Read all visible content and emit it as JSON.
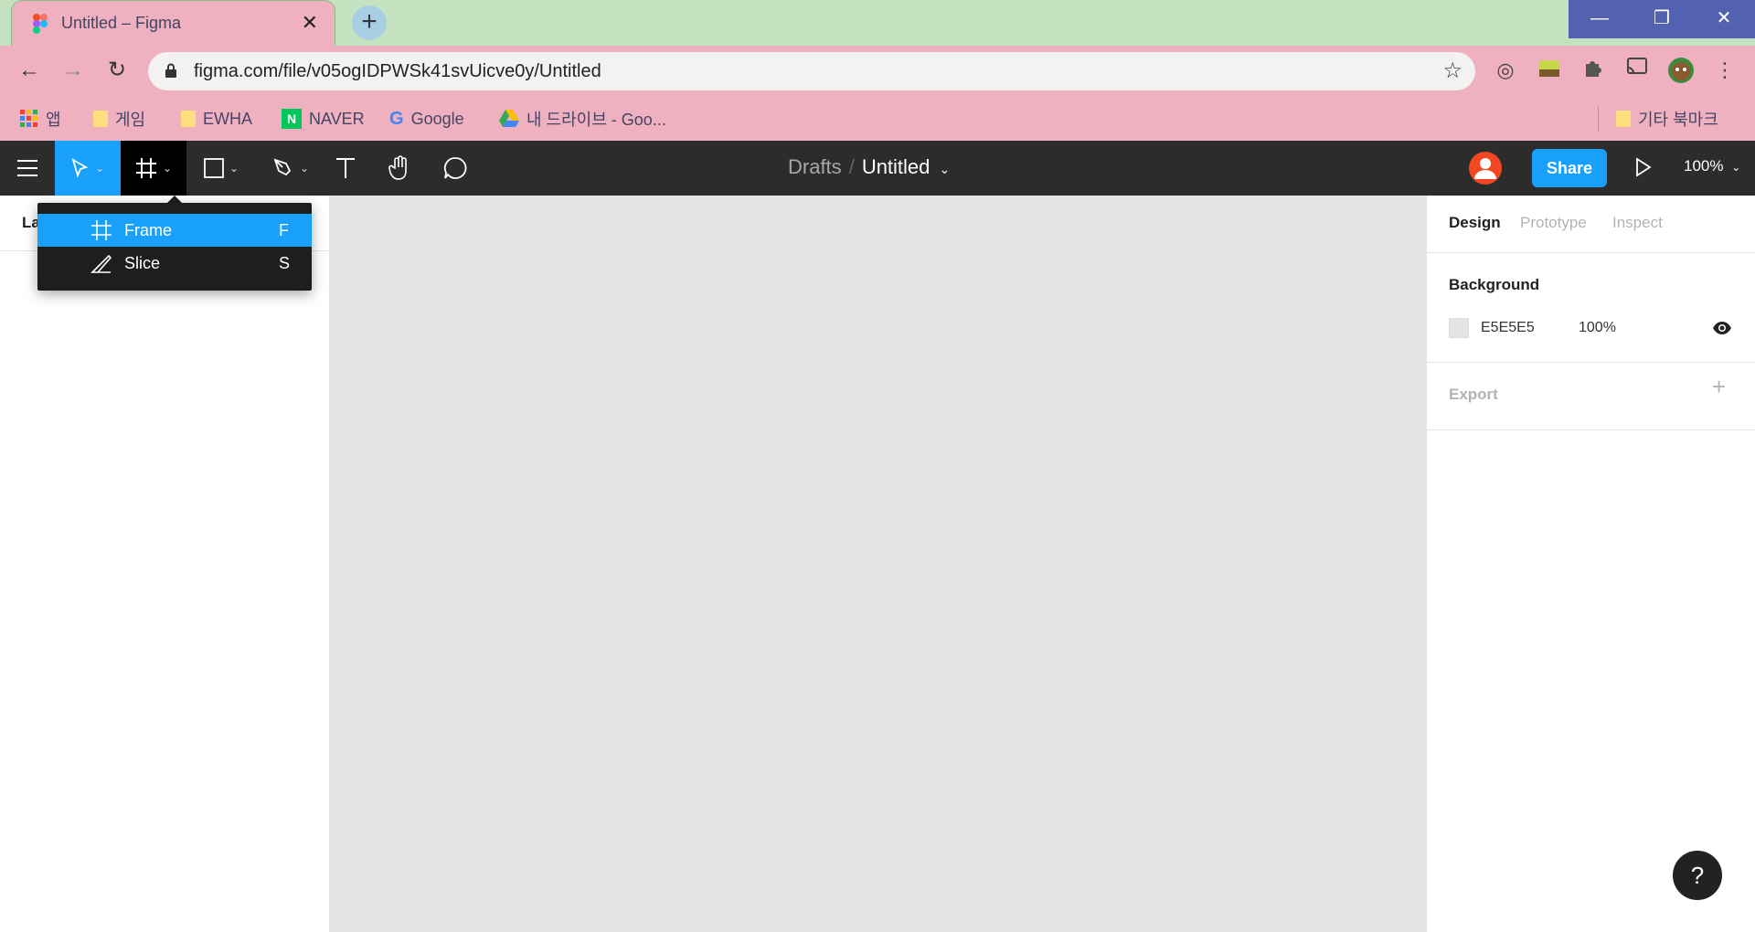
{
  "browser": {
    "tab_title": "Untitled – Figma",
    "tab_close": "✕",
    "new_tab": "+",
    "url": "figma.com/file/v05ogIDPWSk41svUicve0y/Untitled",
    "window_controls": {
      "minimize": "—",
      "restore": "❐",
      "close": "✕"
    },
    "nav": {
      "back": "←",
      "forward": "→",
      "reload": "↻"
    },
    "extensions": [
      "globe-icon",
      "extension-app-icon",
      "puzzle-icon",
      "cast-icon",
      "profile-avatar",
      "kebab-menu-icon"
    ],
    "bookmarks": [
      {
        "label": "앱",
        "icon": "apps-grid-icon"
      },
      {
        "label": "게임",
        "icon": "folder-icon"
      },
      {
        "label": "EWHA",
        "icon": "folder-icon"
      },
      {
        "label": "NAVER",
        "icon": "naver-icon"
      },
      {
        "label": "Google",
        "icon": "google-icon"
      },
      {
        "label": "내 드라이브 - Goo...",
        "icon": "drive-icon"
      }
    ],
    "other_bookmarks": "기타 북마크"
  },
  "toolbar": {
    "breadcrumb_drafts": "Drafts",
    "breadcrumb_sep": "/",
    "file_name": "Untitled",
    "share_label": "Share",
    "zoom": "100%"
  },
  "left_panel": {
    "tab_label": "La"
  },
  "menu": {
    "items": [
      {
        "label": "Frame",
        "shortcut": "F",
        "icon": "frame-icon",
        "selected": true
      },
      {
        "label": "Slice",
        "shortcut": "S",
        "icon": "slice-icon",
        "selected": false
      }
    ]
  },
  "right_panel": {
    "tabs": [
      "Design",
      "Prototype",
      "Inspect"
    ],
    "background_heading": "Background",
    "background_hex": "E5E5E5",
    "background_opacity": "100%",
    "export_heading": "Export",
    "export_add": "+"
  },
  "help": "?",
  "colors": {
    "accent": "#18a0fb",
    "toolbar_bg": "#2c2c2c",
    "canvas": "#e5e5e5",
    "browser_tab_bg": "#efb1c0",
    "browser_strip_bg": "#c4e2bf"
  }
}
